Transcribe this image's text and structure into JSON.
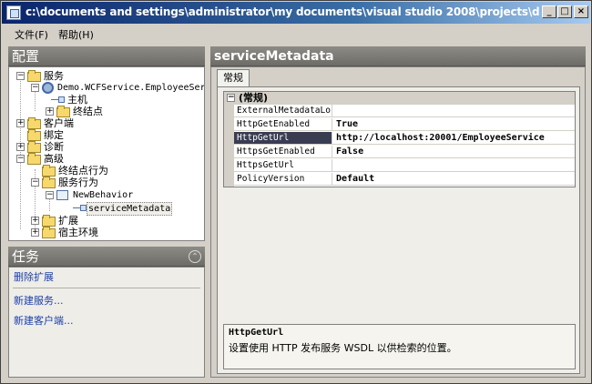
{
  "window": {
    "title": "c:\\documents and settings\\administrator\\my documents\\visual studio 2008\\projects\\demo.edm\\demo.wcfh..."
  },
  "titlebar_buttons": {
    "min": "_",
    "max": "□",
    "close": "×"
  },
  "menu": {
    "file": "文件(F)",
    "help": "帮助(H)"
  },
  "left": {
    "config_title": "配置",
    "tasks_title": "任务"
  },
  "tree": {
    "services": "服务",
    "service_name": "Demo.WCFService.EmployeeService",
    "host": "主机",
    "endpoints": "终结点",
    "clients": "客户端",
    "bindings": "绑定",
    "diagnostics": "诊断",
    "advanced": "高级",
    "endpoint_behaviors": "终结点行为",
    "service_behaviors": "服务行为",
    "new_behavior": "NewBehavior",
    "service_metadata": "serviceMetadata",
    "extensions": "扩展",
    "hosting_env": "宿主环境"
  },
  "tasks": {
    "delete_ext": "删除扩展",
    "new_service": "新建服务...",
    "new_client": "新建客户端..."
  },
  "right": {
    "title": "serviceMetadata",
    "tab": "常规",
    "category": "(常规)",
    "rows": [
      {
        "name": "ExternalMetadataLocation",
        "value": ""
      },
      {
        "name": "HttpGetEnabled",
        "value": "True"
      },
      {
        "name": "HttpGetUrl",
        "value": "http://localhost:20001/EmployeeService"
      },
      {
        "name": "HttpsGetEnabled",
        "value": "False"
      },
      {
        "name": "HttpsGetUrl",
        "value": ""
      },
      {
        "name": "PolicyVersion",
        "value": "Default"
      }
    ],
    "desc_title": "HttpGetUrl",
    "desc_text": "设置使用 HTTP 发布服务 WSDL 以供检索的位置。"
  }
}
